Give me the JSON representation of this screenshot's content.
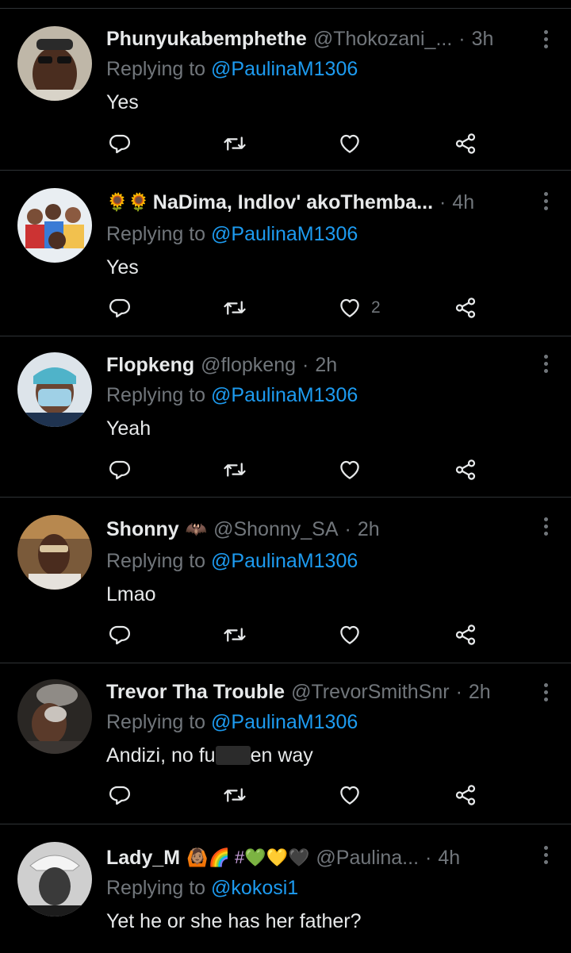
{
  "tweets": [
    {
      "name": "Phunyukabemphethe",
      "handle": "@Thokozani_...",
      "time": "3h",
      "replying_label": "Replying to",
      "replying_to": "@PaulinaM1306",
      "text": "Yes",
      "likes": ""
    },
    {
      "emoji": "🌻🌻",
      "name": "NaDima, Indlov' akoThemba...",
      "handle": "",
      "time": "4h",
      "replying_label": "Replying to",
      "replying_to": "@PaulinaM1306",
      "text": "Yes",
      "likes": "2"
    },
    {
      "name": "Flopkeng",
      "handle": "@flopkeng",
      "time": "2h",
      "replying_label": "Replying to",
      "replying_to": "@PaulinaM1306",
      "text": "Yeah",
      "likes": ""
    },
    {
      "name": "Shonny",
      "emoji": "🦇",
      "handle": "@Shonny_SA",
      "time": "2h",
      "replying_label": "Replying to",
      "replying_to": "@PaulinaM1306",
      "text": "Lmao",
      "likes": ""
    },
    {
      "name": "Trevor Tha Trouble",
      "handle": "@TrevorSmithSnr",
      "time": "2h",
      "replying_label": "Replying to",
      "replying_to": "@PaulinaM1306",
      "text_before": "Andizi,  no fu",
      "text_after": "en way",
      "likes": ""
    },
    {
      "name": "Lady_M",
      "emoji": "🙆🏽🌈 #💚💛🖤",
      "handle": "@Paulina...",
      "time": "4h",
      "replying_label": "Replying to",
      "replying_to": "@kokosi1",
      "text": "Yet he or she has her father?",
      "likes": ""
    }
  ],
  "icons": {
    "reply": "reply-icon",
    "retweet": "retweet-icon",
    "like": "heart-icon",
    "share": "share-icon",
    "more": "more-icon"
  },
  "colors": {
    "background": "#000000",
    "text": "#e7e9ea",
    "secondary": "#71767b",
    "mention": "#1d9bf0",
    "divider": "#2f3336"
  }
}
